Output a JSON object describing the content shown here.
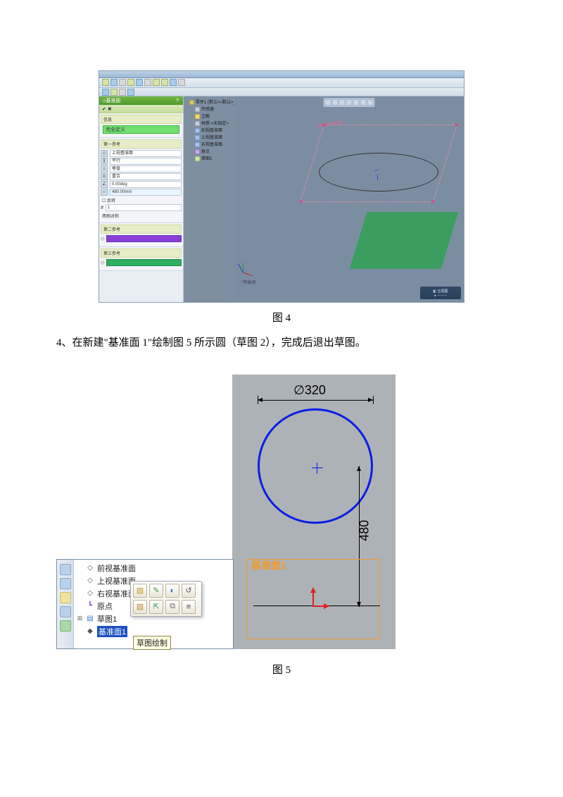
{
  "figure4": {
    "caption": "图 4",
    "window_title": "",
    "propertyManager": {
      "header_title": "基准面",
      "info": "信息",
      "fully_defined": "完全定义",
      "section1_label": "第一参考",
      "ref1_value": "上视基准面",
      "rel_parallel": "平行",
      "rel_perp": "垂直",
      "rel_coincident": "重合",
      "angle_field": "0.00deg",
      "offset_field": "480.00mm",
      "flip_checkbox": "反转",
      "count_field": "1",
      "midplane": "两侧对称",
      "section2_label": "第二参考",
      "section3_label": "第三参考"
    },
    "featureTree": {
      "root": "零件1 (默认<<默认>_显",
      "sensors": "传感器",
      "annotations": "注解",
      "material": "材质 <未指定>",
      "front_plane": "前视基准面",
      "top_plane": "上视基准面",
      "right_plane": "右视基准面",
      "origin": "原点",
      "sketch1": "草图1"
    },
    "canvas": {
      "plane_label": "前视基准面",
      "bottom_label": "*等轴测",
      "status_text": "五视图"
    }
  },
  "instruction_step": "4、在新建\"基准面 1\"绘制图 5 所示圆（草图 2），完成后退出草图。",
  "figure5": {
    "caption": "图 5",
    "diameter_label": "∅320",
    "vertical_dim": "480",
    "plane_label": "基准面1",
    "tree": {
      "front_plane": "前视基准面",
      "top_plane": "上视基准面",
      "right_plane": "右视基准面",
      "origin": "原点",
      "sketch1": "草图1",
      "plane1": "基准面1"
    },
    "tooltip": "草图绘制",
    "context_icons": [
      "feature-icon",
      "sketch-icon",
      "hide-icon",
      "zoom-icon",
      "edit-icon",
      "normal-icon",
      "section-icon",
      "props-icon"
    ]
  }
}
